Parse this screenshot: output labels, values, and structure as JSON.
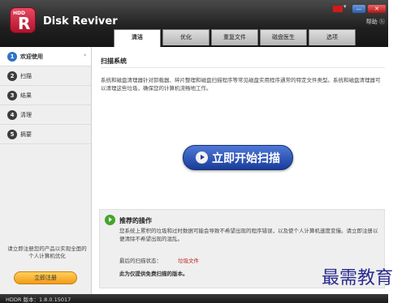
{
  "app": {
    "logo_text": "HDD",
    "logo_letter": "R",
    "title": "Disk Reviver",
    "help": "帮助 ⓗ"
  },
  "tabs": [
    {
      "label": "清洁",
      "active": true
    },
    {
      "label": "优化",
      "active": false
    },
    {
      "label": "重复文件",
      "active": false
    },
    {
      "label": "磁盘医生",
      "active": false
    },
    {
      "label": "选项",
      "active": false
    }
  ],
  "sidebar": {
    "items": [
      {
        "number": "1",
        "label": "欢迎使用",
        "active": true
      },
      {
        "number": "2",
        "label": "扫描",
        "active": false
      },
      {
        "number": "3",
        "label": "结果",
        "active": false
      },
      {
        "number": "4",
        "label": "清理",
        "active": false
      },
      {
        "number": "5",
        "label": "摘要",
        "active": false
      }
    ],
    "promo": "请立即注册您的产品以实现全面的个人计算机优化",
    "register_label": "立即注册"
  },
  "main": {
    "title": "扫描系统",
    "description": "系统和磁盘清理器针对卸载器、碎片整理和磁盘扫描程序等常见磁盘实用程序通常的特定文件类型。系统和磁盘清理器可以清理这些垃圾，确保您的计算机流畅地工作。",
    "scan_button": "立即开始扫描"
  },
  "recommended": {
    "title": "推荐的操作",
    "text": "您系统上累积的垃圾和过时数据可能会导致不希望出现的程序错误，以及使个人计算机速度变慢。请立即注册以便清除不希望出现的混乱。",
    "status_label": "最后的扫描状态：",
    "status_value": "垃圾文件",
    "note": "此为仅提供免费扫描的版本。"
  },
  "status": {
    "version": "HDDR 版本：1.8.0.15017"
  },
  "watermark": "最需教育",
  "colors": {
    "accent_blue": "#1a3d9a",
    "register_orange": "#f29a1a",
    "recommend_green": "#43a52a",
    "status_red": "#c41e1e"
  }
}
